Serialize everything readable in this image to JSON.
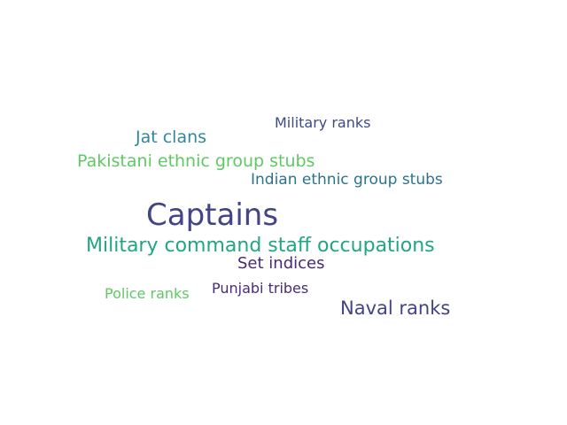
{
  "words": {
    "military_ranks": {
      "text": "Military ranks",
      "color": "#3e4a89"
    },
    "jat_clans": {
      "text": "Jat clans",
      "color": "#31889a"
    },
    "pakistani": {
      "text": "Pakistani ethnic group stubs",
      "color": "#5ec962"
    },
    "indian": {
      "text": "Indian ethnic group stubs",
      "color": "#2c728e"
    },
    "captains": {
      "text": "Captains",
      "color": "#414487"
    },
    "command": {
      "text": "Military command staff occupations",
      "color": "#21a585"
    },
    "set_indices": {
      "text": "Set indices",
      "color": "#482878"
    },
    "punjabi": {
      "text": "Punjabi tribes",
      "color": "#472c7a"
    },
    "police": {
      "text": "Police ranks",
      "color": "#5ec962"
    },
    "naval": {
      "text": "Naval ranks",
      "color": "#414487"
    }
  }
}
